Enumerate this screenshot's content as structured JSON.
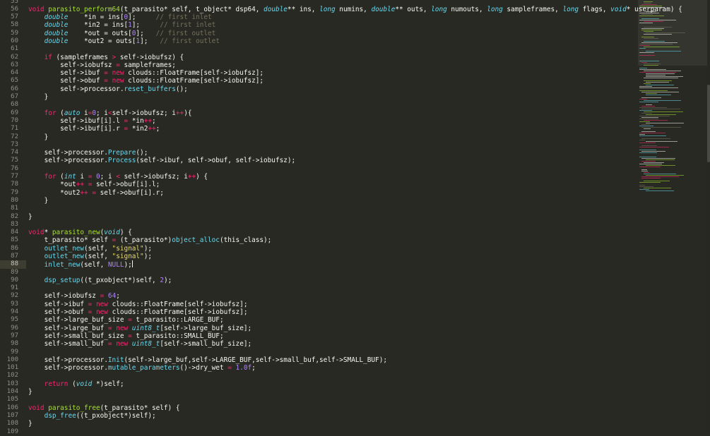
{
  "editor": {
    "theme_colors": {
      "background": "#282923",
      "plain": "#f8f8f2",
      "keyword": "#f92672",
      "storage_type": "#66d9ef",
      "function": "#a6e22e",
      "number": "#ae81ff",
      "string": "#e6db74",
      "comment": "#75715e",
      "line_number": "#8f908a"
    },
    "current_line": "88",
    "lines": [
      {
        "num": "55",
        "tokens": []
      },
      {
        "num": "56",
        "tokens": [
          [
            "k",
            "void"
          ],
          [
            "p",
            " "
          ],
          [
            "f",
            "parasito_perform64"
          ],
          [
            "p",
            "(t_parasito* self, t_object* dsp64, "
          ],
          [
            "t",
            "double"
          ],
          [
            "p",
            "** ins, "
          ],
          [
            "t",
            "long"
          ],
          [
            "p",
            " numins, "
          ],
          [
            "t",
            "double"
          ],
          [
            "p",
            "** outs, "
          ],
          [
            "t",
            "long"
          ],
          [
            "p",
            " numouts, "
          ],
          [
            "t",
            "long"
          ],
          [
            "p",
            " sampleframes, "
          ],
          [
            "t",
            "long"
          ],
          [
            "p",
            " flags, "
          ],
          [
            "t",
            "void"
          ],
          [
            "p",
            "* userparam) {"
          ]
        ]
      },
      {
        "num": "57",
        "tokens": [
          [
            "p",
            "    "
          ],
          [
            "t",
            "double"
          ],
          [
            "p",
            "    *in = ins["
          ],
          [
            "n",
            "0"
          ],
          [
            "p",
            "];     "
          ],
          [
            "c",
            "// first inlet"
          ]
        ]
      },
      {
        "num": "58",
        "tokens": [
          [
            "p",
            "    "
          ],
          [
            "t",
            "double"
          ],
          [
            "p",
            "    *in2 = ins["
          ],
          [
            "n",
            "1"
          ],
          [
            "p",
            "];     "
          ],
          [
            "c",
            "// first inlet"
          ]
        ]
      },
      {
        "num": "59",
        "tokens": [
          [
            "p",
            "    "
          ],
          [
            "t",
            "double"
          ],
          [
            "p",
            "    *out = outs["
          ],
          [
            "n",
            "0"
          ],
          [
            "p",
            "];   "
          ],
          [
            "c",
            "// first outlet"
          ]
        ]
      },
      {
        "num": "60",
        "tokens": [
          [
            "p",
            "    "
          ],
          [
            "t",
            "double"
          ],
          [
            "p",
            "    *out2 = outs["
          ],
          [
            "n",
            "1"
          ],
          [
            "p",
            "];   "
          ],
          [
            "c",
            "// first outlet"
          ]
        ]
      },
      {
        "num": "61",
        "tokens": []
      },
      {
        "num": "62",
        "tokens": [
          [
            "p",
            "    "
          ],
          [
            "k",
            "if"
          ],
          [
            "p",
            " (sampleframes "
          ],
          [
            "k",
            ">"
          ],
          [
            "p",
            " self->iobufsz) {"
          ]
        ]
      },
      {
        "num": "63",
        "tokens": [
          [
            "p",
            "        self->iobufsz "
          ],
          [
            "k",
            "="
          ],
          [
            "p",
            " sampleframes;"
          ]
        ]
      },
      {
        "num": "64",
        "tokens": [
          [
            "p",
            "        self->ibuf "
          ],
          [
            "k",
            "="
          ],
          [
            "p",
            " "
          ],
          [
            "k",
            "new"
          ],
          [
            "p",
            " clouds::FloatFrame[self->iobufsz];"
          ]
        ]
      },
      {
        "num": "65",
        "tokens": [
          [
            "p",
            "        self->obuf "
          ],
          [
            "k",
            "="
          ],
          [
            "p",
            " "
          ],
          [
            "k",
            "new"
          ],
          [
            "p",
            " clouds::FloatFrame[self->iobufsz];"
          ]
        ]
      },
      {
        "num": "66",
        "tokens": [
          [
            "p",
            "        self->processor."
          ],
          [
            "fn",
            "reset_buffers"
          ],
          [
            "p",
            "();"
          ]
        ]
      },
      {
        "num": "67",
        "tokens": [
          [
            "p",
            "    }"
          ]
        ]
      },
      {
        "num": "68",
        "tokens": []
      },
      {
        "num": "69",
        "tokens": [
          [
            "p",
            "    "
          ],
          [
            "k",
            "for"
          ],
          [
            "p",
            " ("
          ],
          [
            "t",
            "auto"
          ],
          [
            "p",
            " i"
          ],
          [
            "k",
            "="
          ],
          [
            "n",
            "0"
          ],
          [
            "p",
            "; i"
          ],
          [
            "k",
            "<"
          ],
          [
            "p",
            "self->iobufsz; i"
          ],
          [
            "k",
            "++"
          ],
          [
            "p",
            "){"
          ]
        ]
      },
      {
        "num": "70",
        "tokens": [
          [
            "p",
            "        self->ibuf[i].l "
          ],
          [
            "k",
            "="
          ],
          [
            "p",
            " *in"
          ],
          [
            "k",
            "++"
          ],
          [
            "p",
            ";"
          ]
        ]
      },
      {
        "num": "71",
        "tokens": [
          [
            "p",
            "        self->ibuf[i].r "
          ],
          [
            "k",
            "="
          ],
          [
            "p",
            " *in2"
          ],
          [
            "k",
            "++"
          ],
          [
            "p",
            ";"
          ]
        ]
      },
      {
        "num": "72",
        "tokens": [
          [
            "p",
            "    }"
          ]
        ]
      },
      {
        "num": "73",
        "tokens": []
      },
      {
        "num": "74",
        "tokens": [
          [
            "p",
            "    self->processor."
          ],
          [
            "fn",
            "Prepare"
          ],
          [
            "p",
            "();"
          ]
        ]
      },
      {
        "num": "75",
        "tokens": [
          [
            "p",
            "    self->processor."
          ],
          [
            "fn",
            "Process"
          ],
          [
            "p",
            "(self->ibuf, self->obuf, self->iobufsz);"
          ]
        ]
      },
      {
        "num": "76",
        "tokens": []
      },
      {
        "num": "77",
        "tokens": [
          [
            "p",
            "    "
          ],
          [
            "k",
            "for"
          ],
          [
            "p",
            " ("
          ],
          [
            "t",
            "int"
          ],
          [
            "p",
            " i "
          ],
          [
            "k",
            "="
          ],
          [
            "p",
            " "
          ],
          [
            "n",
            "0"
          ],
          [
            "p",
            "; i "
          ],
          [
            "k",
            "<"
          ],
          [
            "p",
            " self->iobufsz; i"
          ],
          [
            "k",
            "++"
          ],
          [
            "p",
            ") {"
          ]
        ]
      },
      {
        "num": "78",
        "tokens": [
          [
            "p",
            "        *out"
          ],
          [
            "k",
            "++"
          ],
          [
            "p",
            " "
          ],
          [
            "k",
            "="
          ],
          [
            "p",
            " self->obuf[i].l;"
          ]
        ]
      },
      {
        "num": "79",
        "tokens": [
          [
            "p",
            "        *out2"
          ],
          [
            "k",
            "++"
          ],
          [
            "p",
            " "
          ],
          [
            "k",
            "="
          ],
          [
            "p",
            " self->obuf[i].r;"
          ]
        ]
      },
      {
        "num": "80",
        "tokens": [
          [
            "p",
            "    }"
          ]
        ]
      },
      {
        "num": "81",
        "tokens": []
      },
      {
        "num": "82",
        "tokens": [
          [
            "p",
            "}"
          ]
        ]
      },
      {
        "num": "83",
        "tokens": []
      },
      {
        "num": "84",
        "tokens": [
          [
            "k",
            "void"
          ],
          [
            "p",
            "* "
          ],
          [
            "f",
            "parasito_new"
          ],
          [
            "p",
            "("
          ],
          [
            "t",
            "void"
          ],
          [
            "p",
            ") {"
          ]
        ]
      },
      {
        "num": "85",
        "tokens": [
          [
            "p",
            "    t_parasito* self "
          ],
          [
            "k",
            "="
          ],
          [
            "p",
            " (t_parasito*)"
          ],
          [
            "fn",
            "object_alloc"
          ],
          [
            "p",
            "(this_class);"
          ]
        ]
      },
      {
        "num": "86",
        "tokens": [
          [
            "p",
            "    "
          ],
          [
            "fn",
            "outlet_new"
          ],
          [
            "p",
            "(self, "
          ],
          [
            "s",
            "\"signal\""
          ],
          [
            "p",
            ");"
          ]
        ]
      },
      {
        "num": "87",
        "tokens": [
          [
            "p",
            "    "
          ],
          [
            "fn",
            "outlet_new"
          ],
          [
            "p",
            "(self, "
          ],
          [
            "s",
            "\"signal\""
          ],
          [
            "p",
            ");"
          ]
        ]
      },
      {
        "num": "88",
        "tokens": [
          [
            "p",
            "    "
          ],
          [
            "fn",
            "inlet_new"
          ],
          [
            "p",
            "(self, "
          ],
          [
            "n",
            "NULL"
          ],
          [
            "p",
            ");"
          ]
        ]
      },
      {
        "num": "89",
        "tokens": []
      },
      {
        "num": "90",
        "tokens": [
          [
            "p",
            "    "
          ],
          [
            "fn",
            "dsp_setup"
          ],
          [
            "p",
            "((t_pxobject*)self, "
          ],
          [
            "n",
            "2"
          ],
          [
            "p",
            ");"
          ]
        ]
      },
      {
        "num": "91",
        "tokens": []
      },
      {
        "num": "92",
        "tokens": [
          [
            "p",
            "    self->iobufsz "
          ],
          [
            "k",
            "="
          ],
          [
            "p",
            " "
          ],
          [
            "n",
            "64"
          ],
          [
            "p",
            ";"
          ]
        ]
      },
      {
        "num": "93",
        "tokens": [
          [
            "p",
            "    self->ibuf "
          ],
          [
            "k",
            "="
          ],
          [
            "p",
            " "
          ],
          [
            "k",
            "new"
          ],
          [
            "p",
            " clouds::FloatFrame[self->iobufsz];"
          ]
        ]
      },
      {
        "num": "94",
        "tokens": [
          [
            "p",
            "    self->obuf "
          ],
          [
            "k",
            "="
          ],
          [
            "p",
            " "
          ],
          [
            "k",
            "new"
          ],
          [
            "p",
            " clouds::FloatFrame[self->iobufsz];"
          ]
        ]
      },
      {
        "num": "95",
        "tokens": [
          [
            "p",
            "    self->large_buf_size "
          ],
          [
            "k",
            "="
          ],
          [
            "p",
            " t_parasito::LARGE_BUF;"
          ]
        ]
      },
      {
        "num": "96",
        "tokens": [
          [
            "p",
            "    self->large_buf "
          ],
          [
            "k",
            "="
          ],
          [
            "p",
            " "
          ],
          [
            "k",
            "new"
          ],
          [
            "p",
            " "
          ],
          [
            "t",
            "uint8_t"
          ],
          [
            "p",
            "[self->large_buf_size];"
          ]
        ]
      },
      {
        "num": "97",
        "tokens": [
          [
            "p",
            "    self->small_buf_size "
          ],
          [
            "k",
            "="
          ],
          [
            "p",
            " t_parasito::SMALL_BUF;"
          ]
        ]
      },
      {
        "num": "98",
        "tokens": [
          [
            "p",
            "    self->small_buf "
          ],
          [
            "k",
            "="
          ],
          [
            "p",
            " "
          ],
          [
            "k",
            "new"
          ],
          [
            "p",
            " "
          ],
          [
            "t",
            "uint8_t"
          ],
          [
            "p",
            "[self->small_buf_size];"
          ]
        ]
      },
      {
        "num": "99",
        "tokens": []
      },
      {
        "num": "100",
        "tokens": [
          [
            "p",
            "    self->processor."
          ],
          [
            "fn",
            "Init"
          ],
          [
            "p",
            "(self->large_buf,self->LARGE_BUF,self->small_buf,self->SMALL_BUF);"
          ]
        ]
      },
      {
        "num": "101",
        "tokens": [
          [
            "p",
            "    self->processor."
          ],
          [
            "fn",
            "mutable_parameters"
          ],
          [
            "p",
            "()->dry_wet "
          ],
          [
            "k",
            "="
          ],
          [
            "p",
            " "
          ],
          [
            "n",
            "1.0f"
          ],
          [
            "p",
            ";"
          ]
        ]
      },
      {
        "num": "102",
        "tokens": []
      },
      {
        "num": "103",
        "tokens": [
          [
            "p",
            "    "
          ],
          [
            "k",
            "return"
          ],
          [
            "p",
            " ("
          ],
          [
            "t",
            "void"
          ],
          [
            "p",
            " *)self;"
          ]
        ]
      },
      {
        "num": "104",
        "tokens": [
          [
            "p",
            "}"
          ]
        ]
      },
      {
        "num": "105",
        "tokens": []
      },
      {
        "num": "106",
        "tokens": [
          [
            "k",
            "void"
          ],
          [
            "p",
            " "
          ],
          [
            "f",
            "parasito_free"
          ],
          [
            "p",
            "(t_parasito* self) {"
          ]
        ]
      },
      {
        "num": "107",
        "tokens": [
          [
            "p",
            "    "
          ],
          [
            "fn",
            "dsp_free"
          ],
          [
            "p",
            "((t_pxobject*)self);"
          ]
        ]
      },
      {
        "num": "108",
        "tokens": [
          [
            "p",
            "}"
          ]
        ]
      },
      {
        "num": "109",
        "tokens": []
      }
    ]
  },
  "minimap": {
    "colors": [
      "#66d9ef",
      "#a6e22e",
      "#f8f8f2",
      "#f92672",
      "#75715e"
    ]
  }
}
